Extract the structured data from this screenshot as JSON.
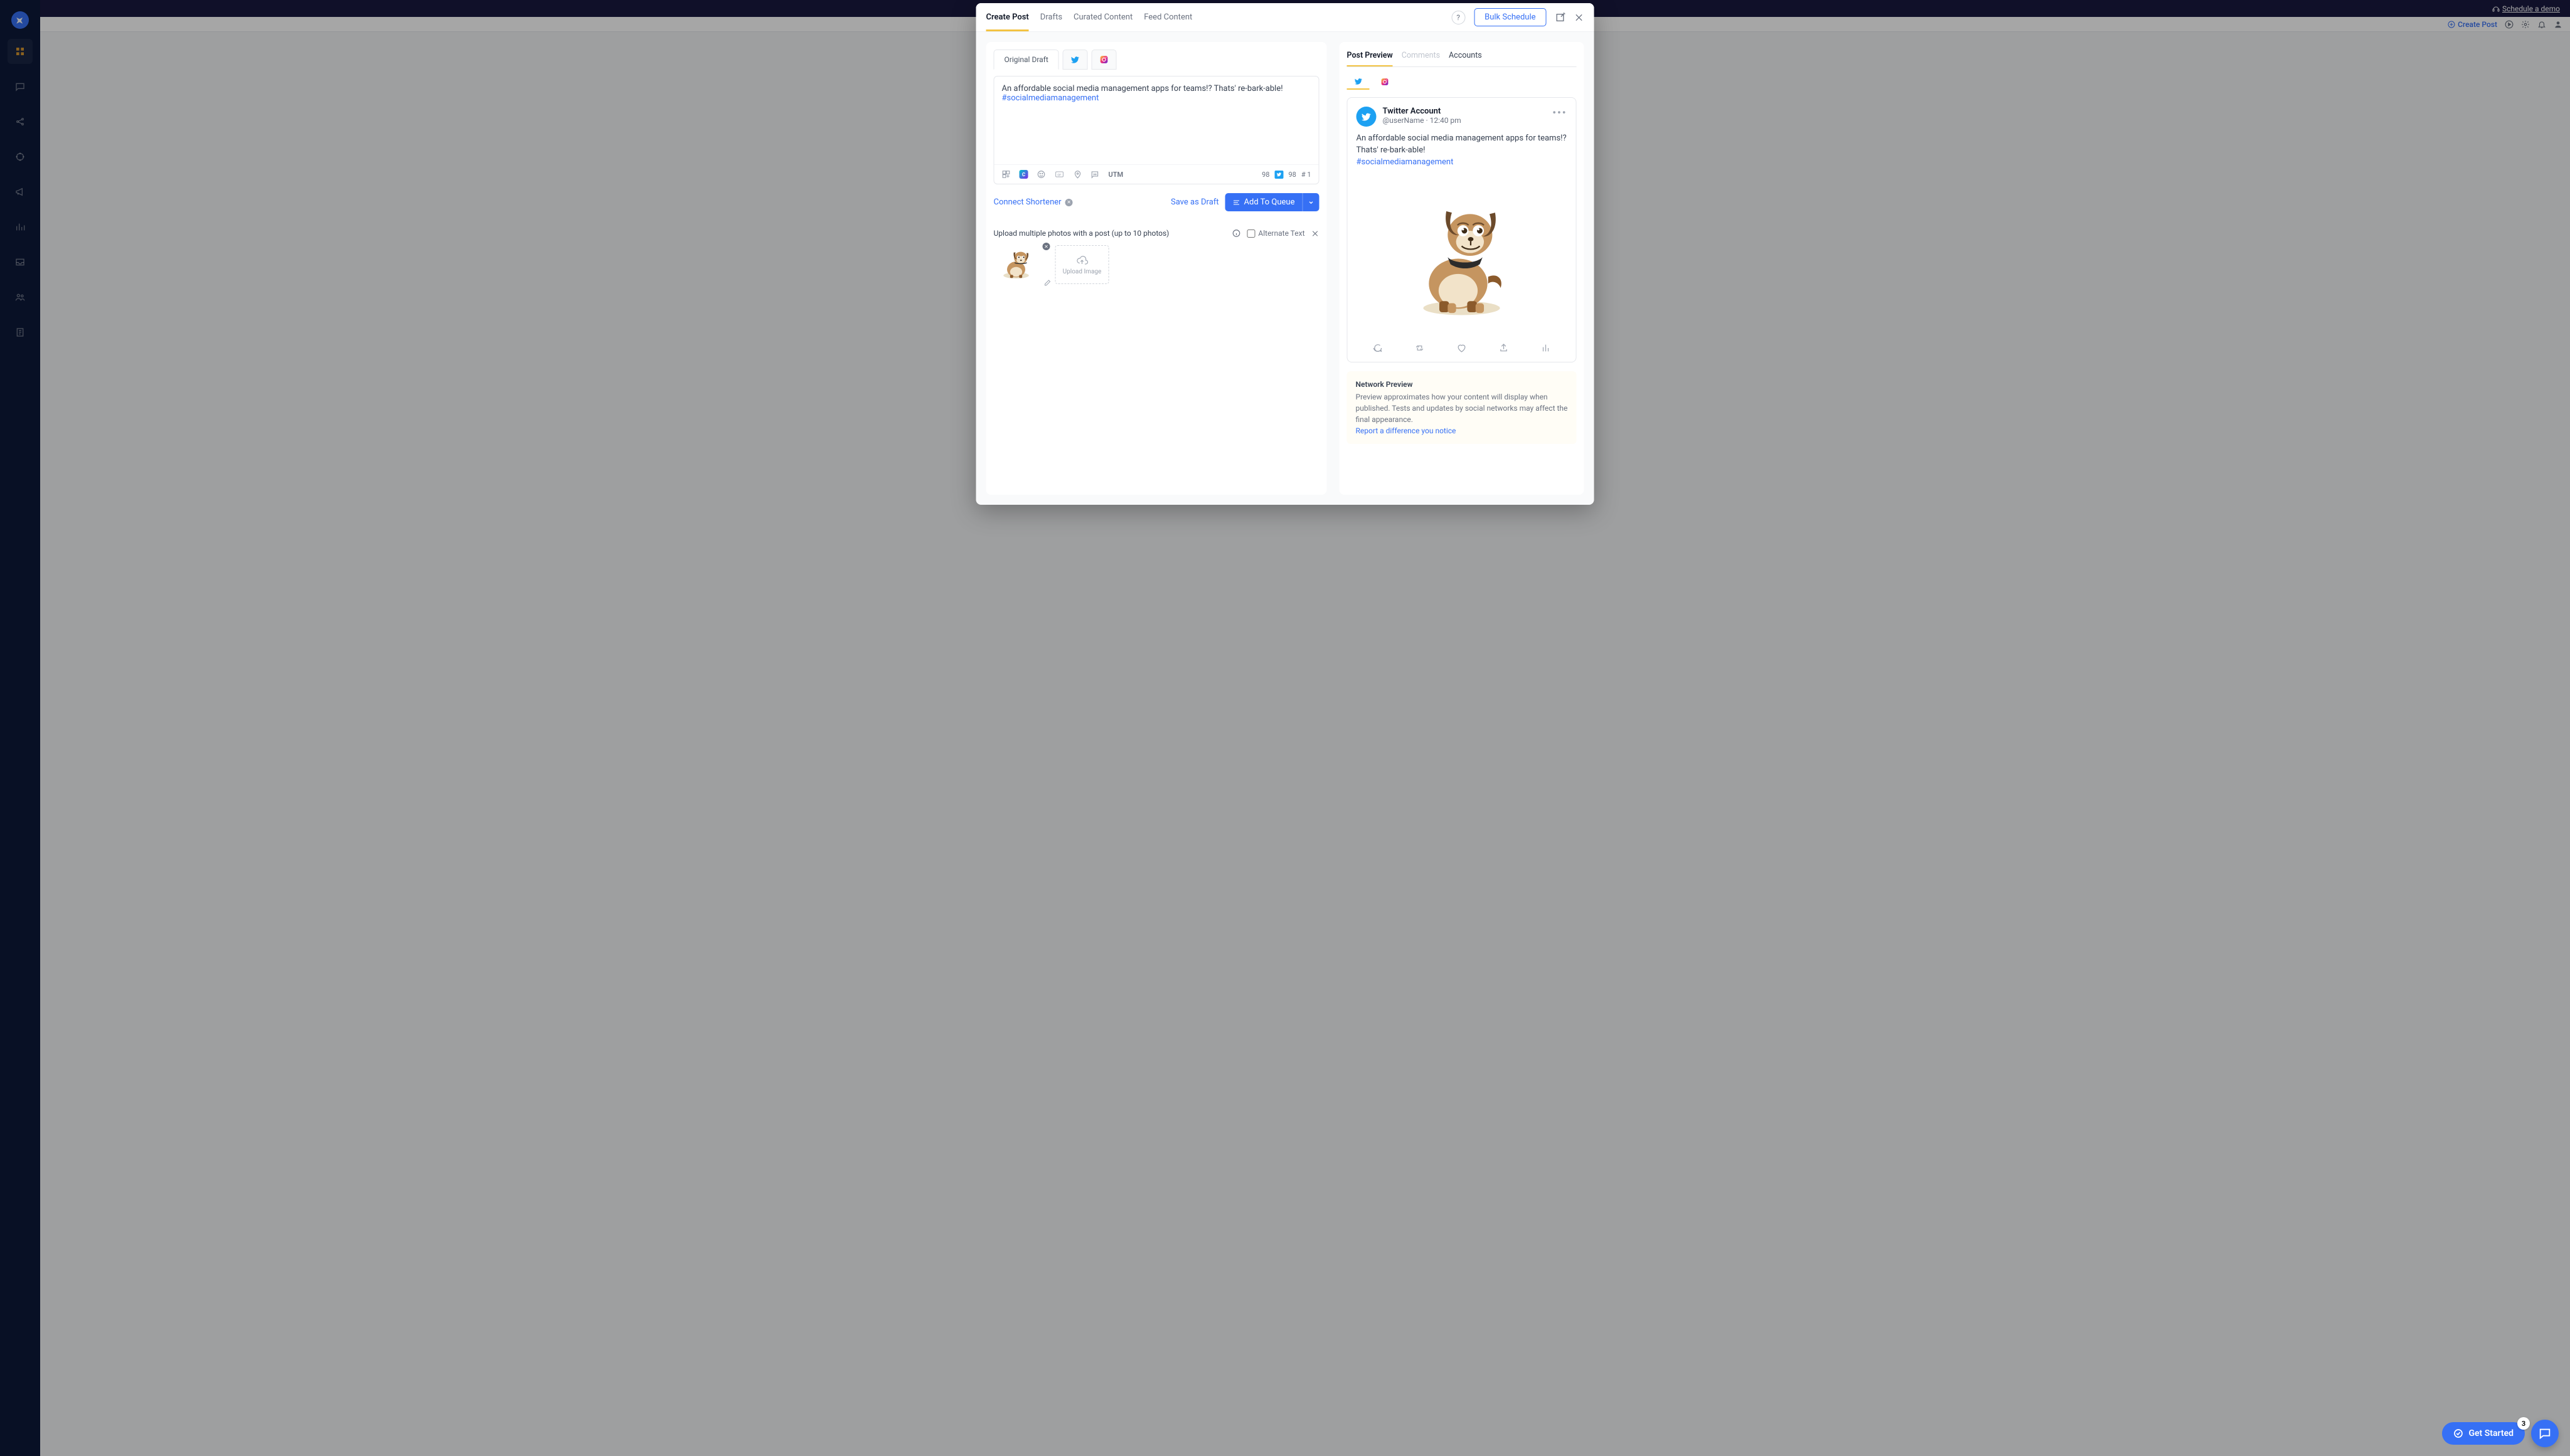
{
  "banner": {
    "schedule_demo": "Schedule a demo"
  },
  "header": {
    "create_post": "Create Post"
  },
  "modal": {
    "tabs": {
      "create": "Create Post",
      "drafts": "Drafts",
      "curated": "Curated Content",
      "feed": "Feed Content"
    },
    "bulk_schedule": "Bulk Schedule"
  },
  "editor": {
    "network_tabs": {
      "original": "Original Draft"
    },
    "text": "An affordable social media management apps for teams!? Thats' re-bark-able! ",
    "hashtag": "#socialmediamanagement",
    "utm_label": "UTM",
    "count_a": "98",
    "count_tw": "98",
    "count_hash": "# 1",
    "connect_shortener": "Connect Shortener",
    "save_draft": "Save as Draft",
    "add_to_queue": "Add To Queue",
    "upload_caption": "Upload multiple photos with a post (up to 10 photos)",
    "alternate_text": "Alternate Text",
    "upload_image": "Upload Image"
  },
  "preview": {
    "tabs": {
      "post": "Post Preview",
      "comments": "Comments",
      "accounts": "Accounts"
    },
    "tw_name": "Twitter Account",
    "tw_handle": "@userName · 12:40 pm",
    "tw_text": "An affordable social media management apps for teams!? Thats' re-bark-able!",
    "tw_hash": "#socialmediamanagement",
    "note_title": "Network Preview",
    "note_body": "Preview approximates how your content will display when published. Tests and updates by social networks may affect the final appearance.",
    "note_link": "Report a difference you notice"
  },
  "footer": {
    "get_started": "Get Started",
    "badge": "3"
  }
}
